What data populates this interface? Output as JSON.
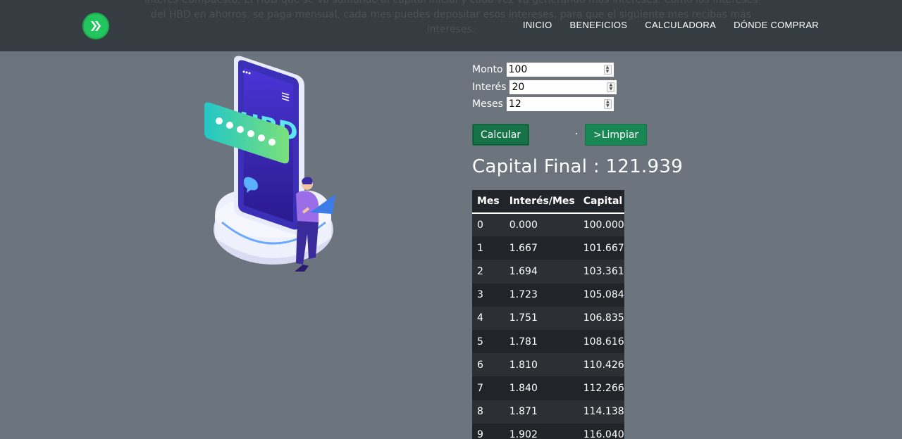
{
  "navbar": {
    "ghost_text": "Interés Compuesto: El HBD que se va sumando al capital inicial y cada vez va generando más intereses. Como los intereses del HBD en ahorros, se paga mensual, cada mes puedes depositar esos intereses, para que el siguiente mes recibas más intereses.",
    "logo_icon": "hive-logo-icon",
    "links": [
      "INICIO",
      "BENEFICIOS",
      "CALCULADORA",
      "DÓNDE COMPRAR"
    ]
  },
  "illustration": {
    "screen_text": "HBD"
  },
  "form": {
    "monto_label": "Monto",
    "monto_value": "100",
    "interes_label": "Interés",
    "interes_value": "20",
    "meses_label": "Meses",
    "meses_value": "12"
  },
  "buttons": {
    "calcular": "Calcular",
    "limpiar": ">Limpiar"
  },
  "result": {
    "capital_final": "Capital Final : 121.939"
  },
  "table": {
    "headers": [
      "Mes",
      "Interés/Mes",
      "Capital"
    ],
    "rows": [
      [
        "0",
        "0.000",
        "100.000"
      ],
      [
        "1",
        "1.667",
        "101.667"
      ],
      [
        "2",
        "1.694",
        "103.361"
      ],
      [
        "3",
        "1.723",
        "105.084"
      ],
      [
        "4",
        "1.751",
        "106.835"
      ],
      [
        "5",
        "1.781",
        "108.616"
      ],
      [
        "6",
        "1.810",
        "110.426"
      ],
      [
        "7",
        "1.840",
        "112.266"
      ],
      [
        "8",
        "1.871",
        "114.138"
      ],
      [
        "9",
        "1.902",
        "116.040"
      ]
    ]
  },
  "colors": {
    "background": "#6c757d",
    "navbar": "#343a40",
    "button": "#198754",
    "logo": "#22c55e"
  }
}
